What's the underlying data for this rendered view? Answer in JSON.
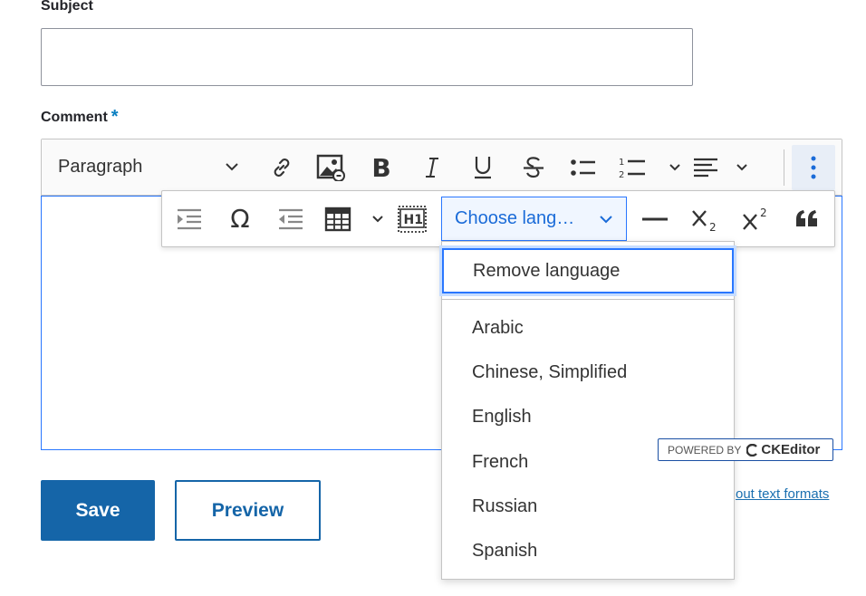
{
  "form": {
    "subject_label": "Subject",
    "subject_value": "",
    "comment_label": "Comment",
    "required_mark": "*"
  },
  "toolbar": {
    "heading_value": "Paragraph",
    "buttons": [
      "link-icon",
      "image-icon",
      "bold-icon",
      "italic-icon",
      "underline-icon",
      "strikethrough-icon",
      "bulleted-list-icon",
      "numbered-list-icon",
      "alignment-icon",
      "more-vertical-icon"
    ]
  },
  "overflow": {
    "buttons": [
      "indent-icon",
      "special-characters-icon",
      "outdent-icon",
      "table-icon",
      "heading-h1-icon",
      "horizontal-line-icon",
      "subscript-icon",
      "superscript-icon",
      "blockquote-icon"
    ],
    "language_dropdown_label": "Choose lang…"
  },
  "language_menu": {
    "remove": "Remove language",
    "items": [
      "Arabic",
      "Chinese, Simplified",
      "English",
      "French",
      "Russian",
      "Spanish"
    ]
  },
  "powered_by": {
    "prefix": "POWERED BY",
    "brand": "CKEditor"
  },
  "actions": {
    "save": "Save",
    "preview": "Preview",
    "about_text_formats": "out text formats"
  },
  "colors": {
    "primary": "#1565a8",
    "focus": "#2977ff",
    "required": "#0a7fc1"
  }
}
